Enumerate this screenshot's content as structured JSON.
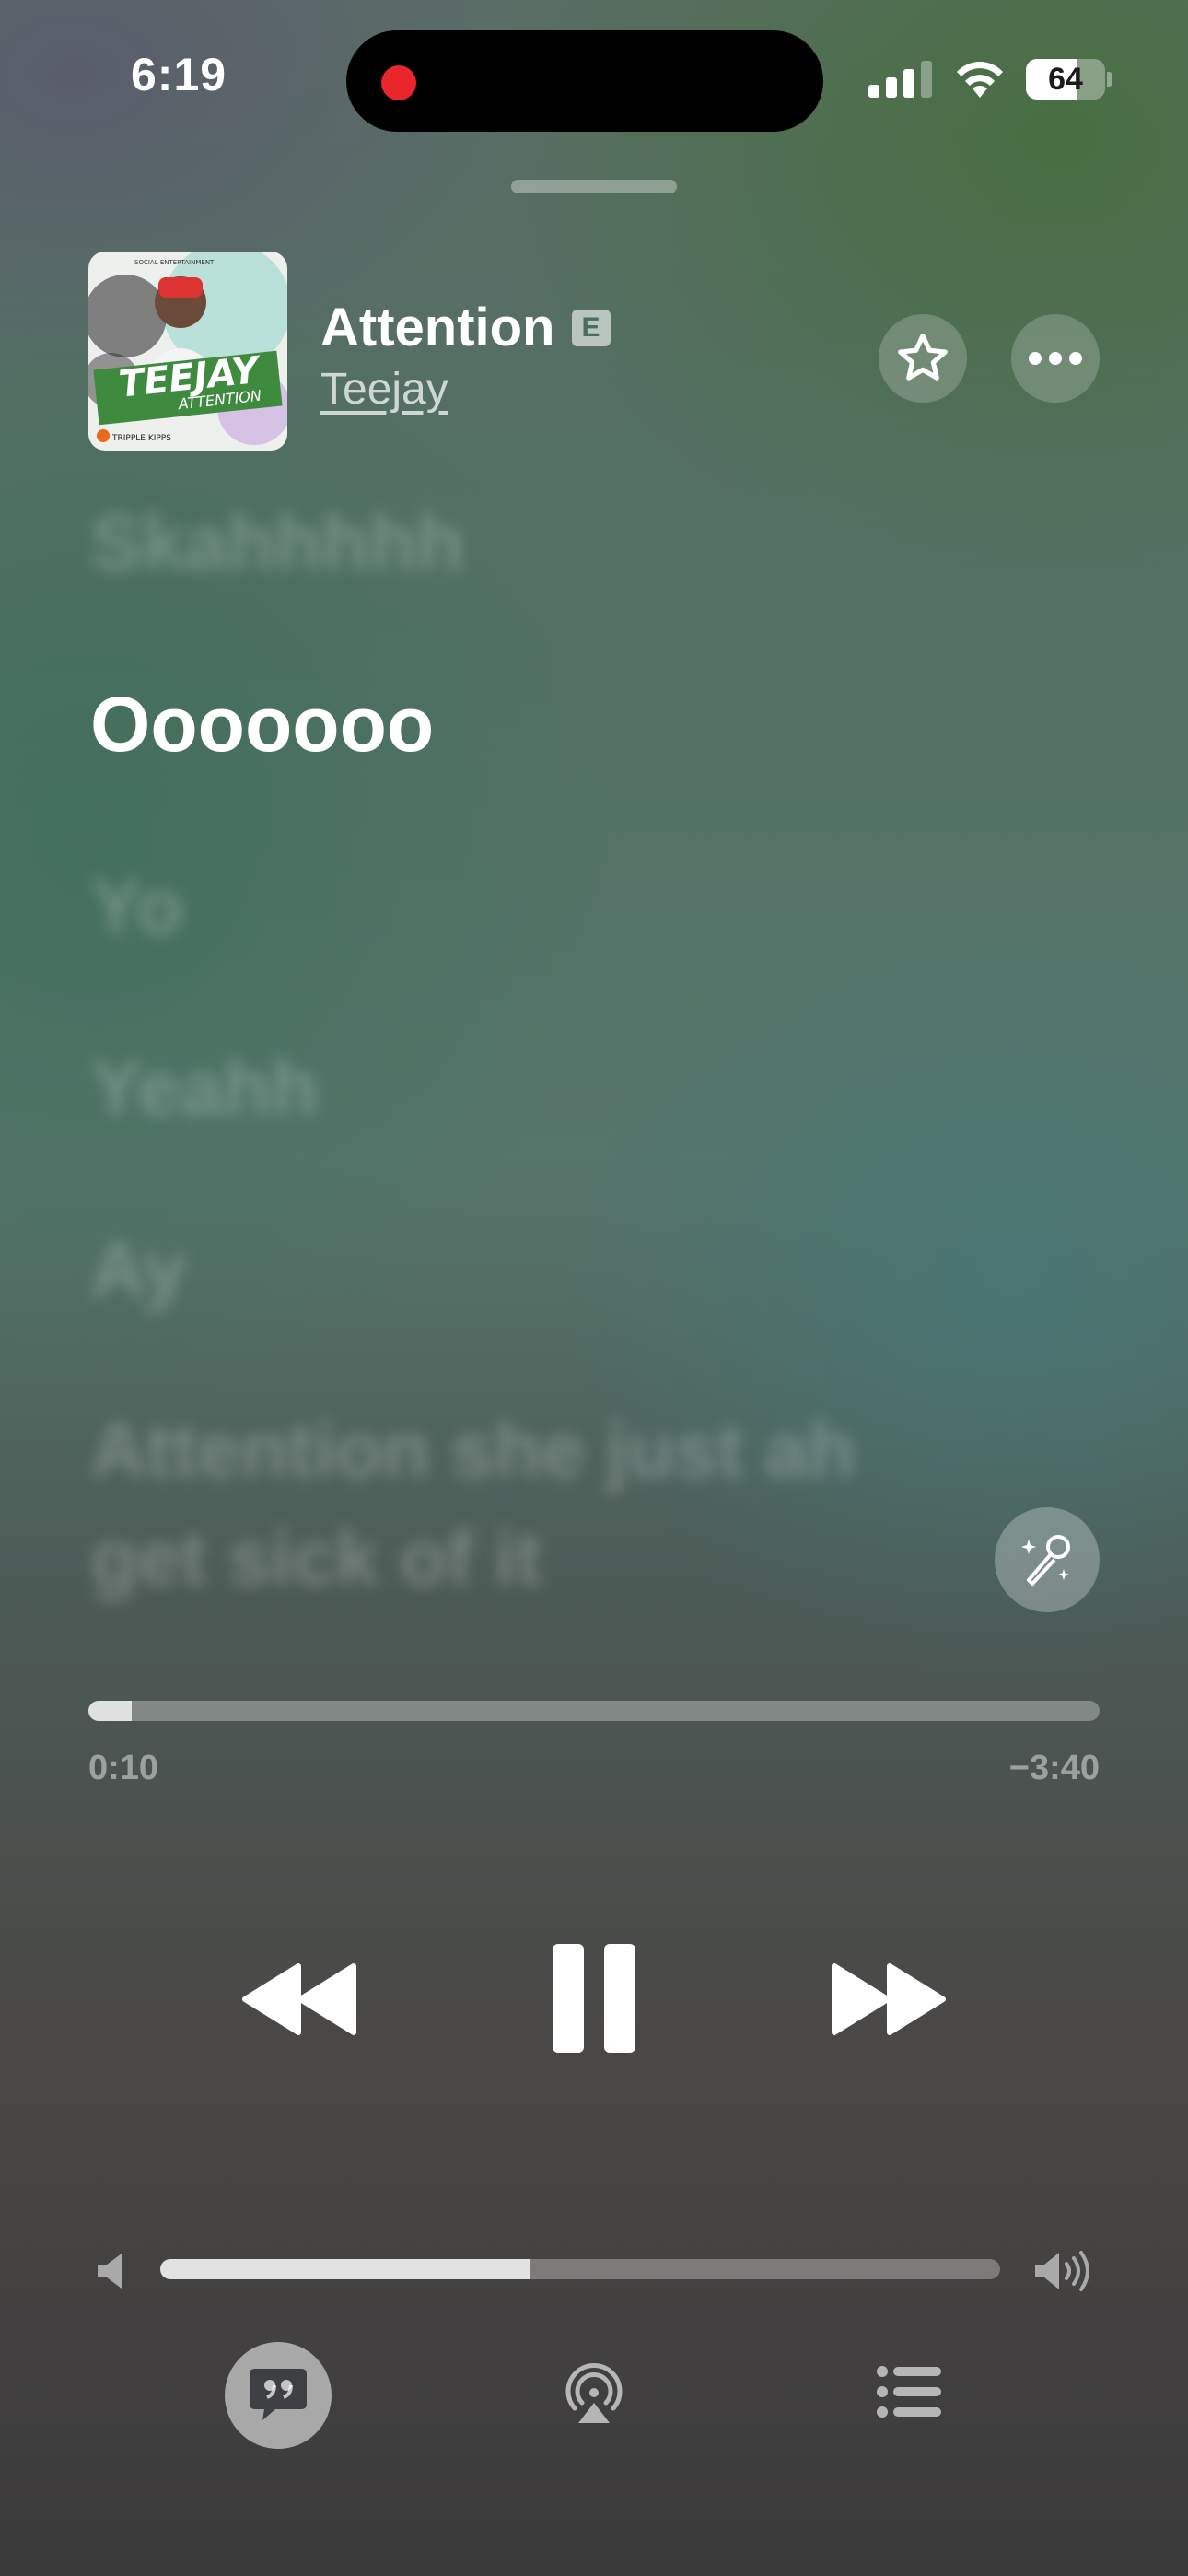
{
  "status_bar": {
    "time": "6:19",
    "battery_level": "64",
    "battery_fraction": 0.64,
    "signal_bars_active": 3,
    "signal_bars_total": 4,
    "recording_indicator_color": "#e8262c"
  },
  "track": {
    "title": "Attention",
    "explicit_badge": "E",
    "artist": "Teejay",
    "album_art": {
      "top_text": "SOCIAL ENTERTAINMENT",
      "artist_text": "TEEJAY",
      "title_text": "ATTENTION",
      "label_text": "TRIPPLE KIPPS",
      "accent_color": "#3e8a3e"
    }
  },
  "header_actions": {
    "favorite_icon": "star-icon",
    "more_icon": "ellipsis-icon"
  },
  "lyrics": {
    "previous_lines": [
      "Skahhhhh"
    ],
    "current_line": "Ooooooo",
    "next_lines": [
      "Yo",
      "Yeahh",
      "Ay",
      "Attention she just ah",
      "get sick of it"
    ]
  },
  "sing_button": {
    "icon": "microphone-sparkle-icon"
  },
  "playback": {
    "elapsed": "0:10",
    "remaining": "−3:40",
    "progress_fraction": 0.043
  },
  "transport": {
    "rewind_icon": "rewind-icon",
    "pause_icon": "pause-icon",
    "forward_icon": "fast-forward-icon"
  },
  "volume": {
    "level_fraction": 0.44,
    "low_icon": "speaker-low-icon",
    "high_icon": "speaker-high-icon"
  },
  "bottom_bar": {
    "lyrics_icon": "lyrics-quote-bubble-icon",
    "airplay_icon": "airplay-audio-icon",
    "queue_icon": "queue-list-icon"
  }
}
